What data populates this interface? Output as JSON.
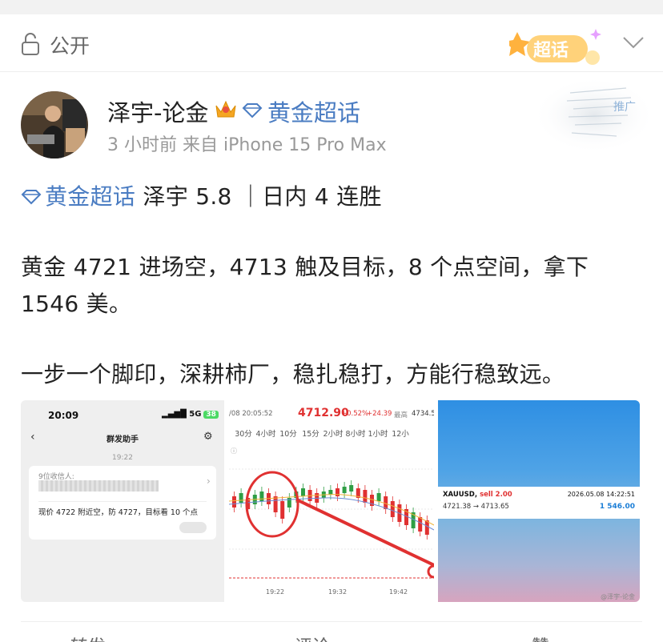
{
  "header": {
    "visibility_label": "公开",
    "badge_text": "超话"
  },
  "post": {
    "author": "泽宇-论金",
    "topic_name": "黄金超话",
    "time": "3 小时前",
    "source": "来自 iPhone 15 Pro Max",
    "ad_label": "推广"
  },
  "body": {
    "topic_tag": "黄金超话",
    "line1_rest": " 泽宇 5.8 ｜日内 4 连胜",
    "line2": "黄金 4721 进场空，4713 触及目标，8 个点空间，拿下",
    "line3": "1546 美。",
    "line4": "一步一个脚印，深耕柿厂，稳扎稳打，方能行稳致远。"
  },
  "images": {
    "img1": {
      "time": "20:09",
      "signal": "5G",
      "battery": "38",
      "title": "群发助手",
      "stamp": "19:22",
      "recipients": "9位收信人:",
      "message": "现价 4722 附近空，防 4727，目标看 10 个点"
    },
    "img2": {
      "date": "/08 20:05:52",
      "price": "4712.90",
      "pct": "+0.52%",
      "change": "+24.39",
      "high_label": "最高",
      "high_value": "4734.5",
      "tabs": [
        "30分",
        "4小时",
        "10分",
        "15分",
        "2小时",
        "8小时",
        "1小时",
        "12小"
      ],
      "time_ticks": [
        "19:22",
        "19:32",
        "19:42"
      ]
    },
    "img3": {
      "symbol": "XAUUSD,",
      "side": "sell 2.00",
      "datetime": "2026.05.08 14:22:51",
      "prices": "4721.38 → 4713.65",
      "profit": "1 546.00",
      "watermark": "@泽宇-论金"
    }
  },
  "actions": {
    "repost": "转发",
    "comment": "评论",
    "like": "赞"
  },
  "colors": {
    "link_blue": "#4a7cc2",
    "up_red": "#e03131",
    "profit_blue": "#1c7ed6"
  }
}
